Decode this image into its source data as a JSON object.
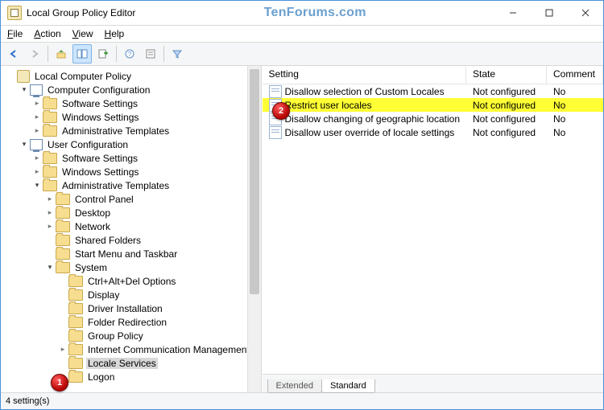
{
  "title": "Local Group Policy Editor",
  "watermark": "TenForums.com",
  "menu": {
    "file": "File",
    "action": "Action",
    "view": "View",
    "help": "Help"
  },
  "tree": {
    "root": "Local Computer Policy",
    "cc": "Computer Configuration",
    "cc_sw": "Software Settings",
    "cc_ws": "Windows Settings",
    "cc_at": "Administrative Templates",
    "uc": "User Configuration",
    "uc_sw": "Software Settings",
    "uc_ws": "Windows Settings",
    "uc_at": "Administrative Templates",
    "cp": "Control Panel",
    "dk": "Desktop",
    "nw": "Network",
    "sf": "Shared Folders",
    "smt": "Start Menu and Taskbar",
    "sys": "System",
    "cad": "Ctrl+Alt+Del Options",
    "disp": "Display",
    "drv": "Driver Installation",
    "fr": "Folder Redirection",
    "gp": "Group Policy",
    "icm": "Internet Communication Management",
    "ls": "Locale Services",
    "lg": "Logon"
  },
  "cols": {
    "setting": "Setting",
    "state": "State",
    "comment": "Comment"
  },
  "rows": [
    {
      "s": "Disallow selection of Custom Locales",
      "st": "Not configured",
      "c": "No"
    },
    {
      "s": "Restrict user locales",
      "st": "Not configured",
      "c": "No"
    },
    {
      "s": "Disallow changing of geographic location",
      "st": "Not configured",
      "c": "No"
    },
    {
      "s": "Disallow user override of locale settings",
      "st": "Not configured",
      "c": "No"
    }
  ],
  "tabs": {
    "ext": "Extended",
    "std": "Standard"
  },
  "status": "4 setting(s)",
  "callouts": {
    "1": "1",
    "2": "2"
  }
}
